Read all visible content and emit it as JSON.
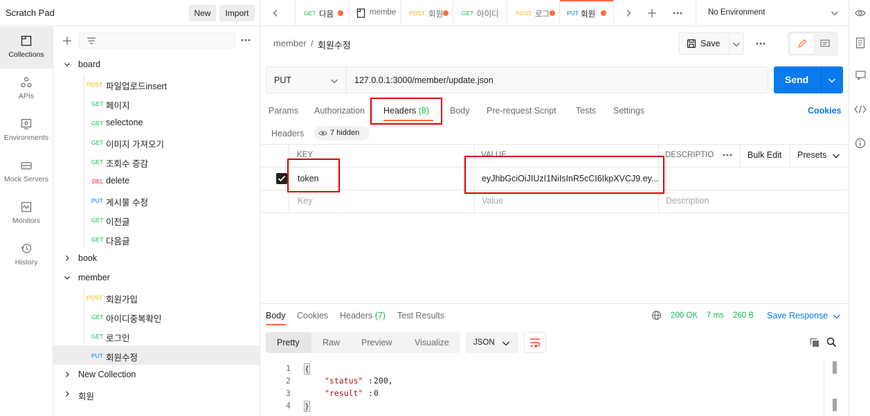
{
  "workspace": {
    "title": "Scratch Pad",
    "new_label": "New",
    "import_label": "Import"
  },
  "rail": [
    {
      "label": "Collections",
      "icon": "collections-icon"
    },
    {
      "label": "APIs",
      "icon": "apis-icon"
    },
    {
      "label": "Environments",
      "icon": "environments-icon"
    },
    {
      "label": "Mock Servers",
      "icon": "mock-servers-icon"
    },
    {
      "label": "Monitors",
      "icon": "monitors-icon"
    },
    {
      "label": "History",
      "icon": "history-icon"
    }
  ],
  "tree": {
    "folders": {
      "board": "board",
      "book": "book",
      "member": "member",
      "new_collection": "New Collection",
      "hoewon": "회원"
    },
    "board_requests": [
      {
        "method": "POST",
        "name": "파일업로드insert"
      },
      {
        "method": "GET",
        "name": "페이지"
      },
      {
        "method": "GET",
        "name": "selectone"
      },
      {
        "method": "GET",
        "name": "이미지 가져오기"
      },
      {
        "method": "GET",
        "name": "조회수 증감"
      },
      {
        "method": "DEL",
        "name": "delete"
      },
      {
        "method": "PUT",
        "name": "게시물 수정"
      },
      {
        "method": "GET",
        "name": "이전글"
      },
      {
        "method": "GET",
        "name": "다음글"
      }
    ],
    "member_requests": [
      {
        "method": "POST",
        "name": "회원가입"
      },
      {
        "method": "GET",
        "name": "아이디중복확인"
      },
      {
        "method": "GET",
        "name": "로그인"
      },
      {
        "method": "PUT",
        "name": "회원수정"
      }
    ]
  },
  "tabs": [
    {
      "method": "GET",
      "name": "다음"
    },
    {
      "method": "",
      "name": "membe"
    },
    {
      "method": "POST",
      "name": "회원"
    },
    {
      "method": "GET",
      "name": "아이디"
    },
    {
      "method": "POST",
      "name": "로그"
    },
    {
      "method": "PUT",
      "name": "회원"
    }
  ],
  "environment": "No Environment",
  "breadcrumb": {
    "parent": "member",
    "sep": "/",
    "current": "회원수정"
  },
  "save_label": "Save",
  "request": {
    "method": "PUT",
    "url": "127.0.0.1:3000/member/update.json",
    "send_label": "Send"
  },
  "subtabs": {
    "params": "Params",
    "authorization": "Authorization",
    "headers": "Headers",
    "headers_count": "(8)",
    "body": "Body",
    "prerequest": "Pre-request Script",
    "tests": "Tests",
    "settings": "Settings",
    "cookies": "Cookies"
  },
  "headers_section": {
    "title": "Headers",
    "hidden": "7 hidden"
  },
  "headers_table": {
    "col_key": "KEY",
    "col_value": "VALUE",
    "col_desc": "DESCRIPTIO",
    "bulk_edit": "Bulk Edit",
    "presets": "Presets",
    "row_key": "token",
    "row_value": "eyJhbGciOiJIUzI1NiIsInR5cCI6IkpXVCJ9.ey...",
    "ph_key": "Key",
    "ph_value": "Value",
    "ph_desc": "Description"
  },
  "response": {
    "tabs": {
      "body": "Body",
      "cookies": "Cookies",
      "headers": "Headers",
      "headers_count": "(7)",
      "test_results": "Test Results"
    },
    "status": "200 OK",
    "time": "7 ms",
    "size": "260 B",
    "save_response": "Save Response",
    "views": {
      "pretty": "Pretty",
      "raw": "Raw",
      "preview": "Preview",
      "visualize": "Visualize"
    },
    "format": "JSON",
    "lines": [
      {
        "n": "1",
        "text": "{"
      },
      {
        "n": "2",
        "key": "\"status\"",
        "val": "200,"
      },
      {
        "n": "3",
        "key": "\"result\"",
        "val": "0"
      },
      {
        "n": "4",
        "text": "}"
      }
    ]
  },
  "colors": {
    "accent": "#ff6c37",
    "send": "#097bed",
    "get": "#0cbb52",
    "post": "#ffb400",
    "put": "#097bed",
    "del": "#eb2013",
    "highlight": "#e00000"
  }
}
